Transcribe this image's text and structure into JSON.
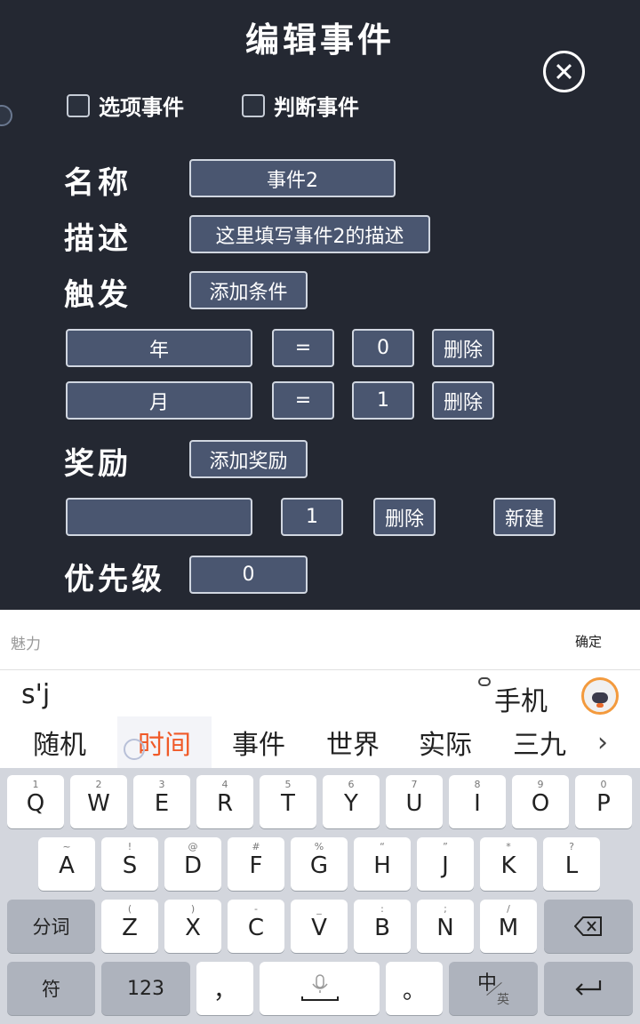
{
  "editor": {
    "title": "编辑事件",
    "checkboxes": [
      {
        "label": "选项事件",
        "checked": false
      },
      {
        "label": "判断事件",
        "checked": false
      }
    ],
    "name_label": "名称",
    "name_value": "事件2",
    "desc_label": "描述",
    "desc_value": "这里填写事件2的描述",
    "trigger_label": "触发",
    "add_condition": "添加条件",
    "conditions": [
      {
        "field": "年",
        "op": "=",
        "value": "0",
        "delete": "删除"
      },
      {
        "field": "月",
        "op": "=",
        "value": "1",
        "delete": "删除"
      }
    ],
    "reward_label": "奖励",
    "add_reward": "添加奖励",
    "reward": {
      "field": "",
      "value": "1",
      "delete": "删除",
      "new": "新建"
    },
    "priority_label": "优先级",
    "priority_value": "0"
  },
  "ime": {
    "input_hint": "魅力",
    "confirm": "确定",
    "pinyin": "s'j",
    "cloud_word": "手机",
    "candidates": [
      "随机",
      "时间",
      "事件",
      "世界",
      "实际",
      "三九"
    ],
    "active_candidate": 1
  },
  "keyboard": {
    "row1": [
      {
        "sub": "1",
        "key": "Q"
      },
      {
        "sub": "2",
        "key": "W"
      },
      {
        "sub": "3",
        "key": "E"
      },
      {
        "sub": "4",
        "key": "R"
      },
      {
        "sub": "5",
        "key": "T"
      },
      {
        "sub": "6",
        "key": "Y"
      },
      {
        "sub": "7",
        "key": "U"
      },
      {
        "sub": "8",
        "key": "I"
      },
      {
        "sub": "9",
        "key": "O"
      },
      {
        "sub": "0",
        "key": "P"
      }
    ],
    "row2": [
      {
        "sub": "~",
        "key": "A"
      },
      {
        "sub": "!",
        "key": "S"
      },
      {
        "sub": "@",
        "key": "D"
      },
      {
        "sub": "#",
        "key": "F"
      },
      {
        "sub": "%",
        "key": "G"
      },
      {
        "sub": "“",
        "key": "H"
      },
      {
        "sub": "”",
        "key": "J"
      },
      {
        "sub": "*",
        "key": "K"
      },
      {
        "sub": "?",
        "key": "L"
      }
    ],
    "row3": [
      {
        "sub": "(",
        "key": "Z"
      },
      {
        "sub": ")",
        "key": "X"
      },
      {
        "sub": "-",
        "key": "C"
      },
      {
        "sub": "_",
        "key": "V"
      },
      {
        "sub": ":",
        "key": "B"
      },
      {
        "sub": ";",
        "key": "N"
      },
      {
        "sub": "/",
        "key": "M"
      }
    ],
    "fenci": "分词",
    "fu": "符",
    "num": "123",
    "comma": "，",
    "period": "。",
    "zh": "中",
    "en": "英"
  }
}
